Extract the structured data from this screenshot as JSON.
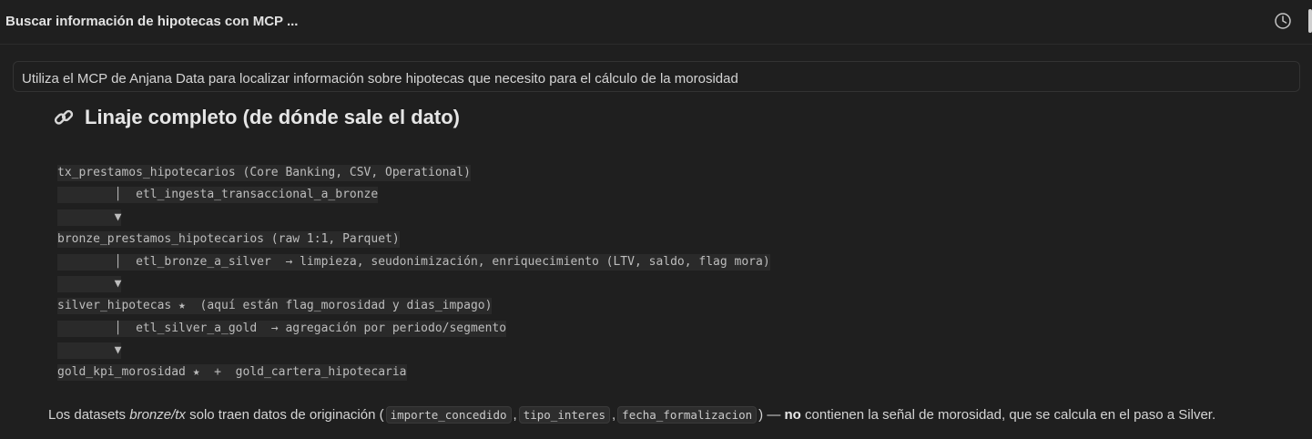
{
  "header": {
    "title": "Buscar información de hipotecas con MCP ...",
    "history_icon": "history-icon"
  },
  "prompt": {
    "text": "Utiliza el MCP de Anjana Data para localizar información sobre hipotecas que necesito para el cálculo de la morosidad"
  },
  "section": {
    "icon": "link-icon",
    "heading": "Linaje completo (de dónde sale el dato)"
  },
  "lineage": [
    "tx_prestamos_hipotecarios (Core Banking, CSV, Operational)",
    "        │  etl_ingesta_transaccional_a_bronze",
    "        ▼",
    "bronze_prestamos_hipotecarios (raw 1:1, Parquet)",
    "        │  etl_bronze_a_silver  → limpieza, seudonimización, enriquecimiento (LTV, saldo, flag mora)",
    "        ▼",
    "silver_hipotecas ★  (aquí están flag_morosidad y dias_impago)",
    "        │  etl_silver_a_gold  → agregación por periodo/segmento",
    "        ▼",
    "gold_kpi_morosidad ★  +  gold_cartera_hipotecaria"
  ],
  "footer": {
    "t1": "Los datasets ",
    "em": "bronze/tx",
    "t2": " solo traen datos de originación (",
    "code1": "importe_concedido",
    "sep1": ",",
    "code2": "tipo_interes",
    "sep2": ",",
    "code3": "fecha_formalizacion",
    "t3": ") — ",
    "strong": "no",
    "t4": " contienen la señal de morosidad, que se calcula en el paso a Silver."
  }
}
